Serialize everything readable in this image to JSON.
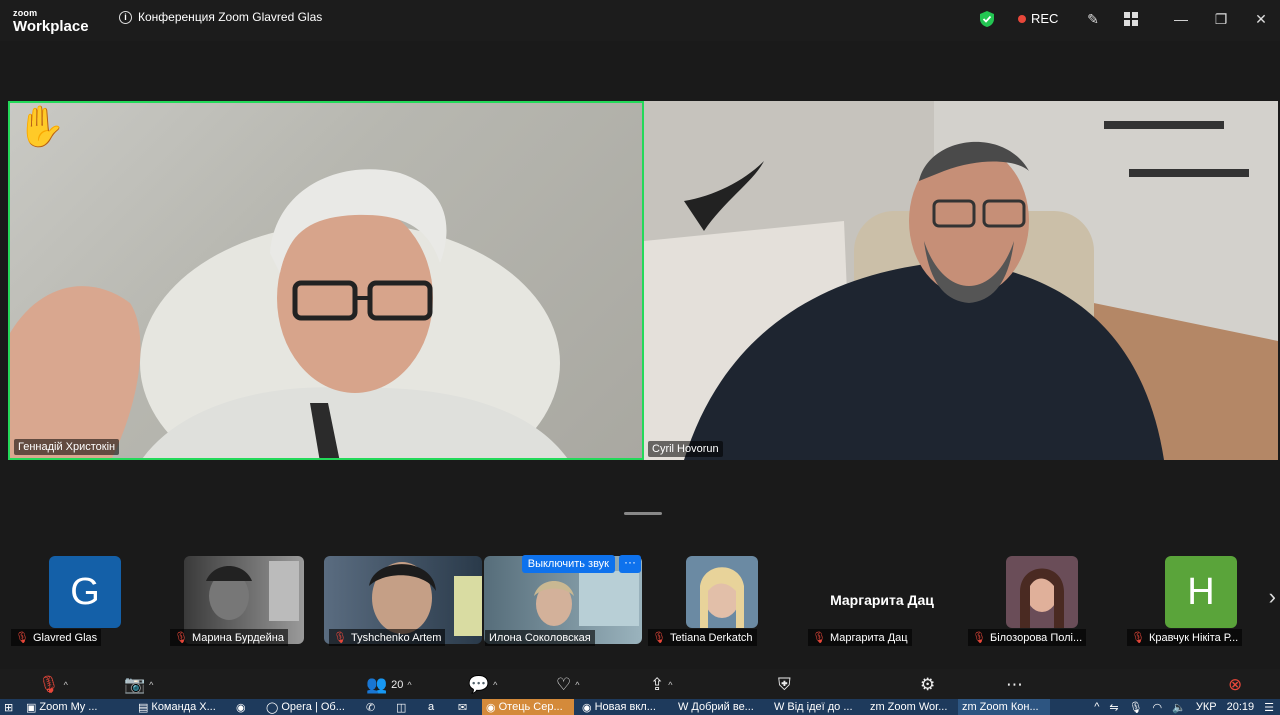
{
  "app": {
    "logo_line1": "zoom",
    "logo_line2": "Workplace",
    "meeting_title": "Конференция Zoom Glavred Glas",
    "rec_label": "REC"
  },
  "main_video": {
    "left_name": "Геннадій Христокін",
    "right_name": "Cyril Hovorun"
  },
  "participants": [
    {
      "name": "Glavred Glas",
      "avatar_letter": "G",
      "avatar_color": "#1460a8"
    },
    {
      "name": "Марина Бурдейна"
    },
    {
      "name": "Tyshchenko Artem"
    },
    {
      "name": "Илона Соколовская",
      "unmute_label": "Выключить звук",
      "more_label": "···"
    },
    {
      "name": "Tetiana Derkatch"
    },
    {
      "name": "Маргарита Дац",
      "display_name": "Маргарита Дац"
    },
    {
      "name": "Білозорова Полі..."
    },
    {
      "name": "Кравчук Нікіта  Р...",
      "avatar_letter": "H",
      "avatar_color": "#5aa43a"
    }
  ],
  "toolbar": {
    "participants_count": "20"
  },
  "taskbar": {
    "items": [
      "Zoom My ...",
      "Команда Х...",
      "Opera | Об...",
      "Отець Сер...",
      "Новая вкл...",
      "Добрий ве...",
      "Від ідеї до ...",
      "Zoom Wor...",
      "Zoom Кон..."
    ],
    "lang": "УКР",
    "time": "20:19"
  },
  "colors": {
    "accent_green": "#23d959",
    "rec_red": "#e8473a",
    "zoom_blue": "#0e72ed"
  }
}
